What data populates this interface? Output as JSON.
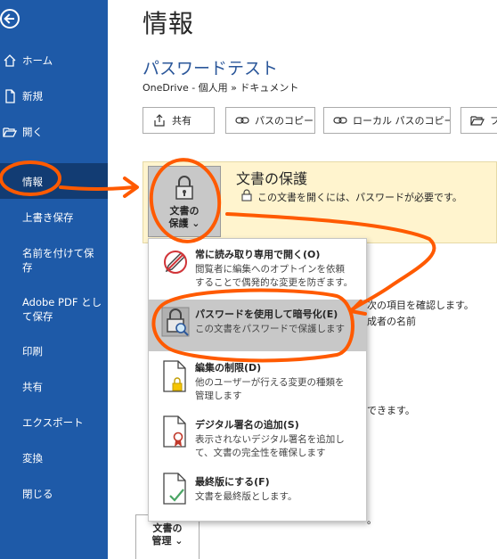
{
  "sidebar": {
    "items": [
      {
        "label": "ホーム"
      },
      {
        "label": "新規"
      },
      {
        "label": "開く"
      },
      {
        "label": "情報"
      },
      {
        "label": "上書き保存"
      },
      {
        "label": "名前を付けて保\n存"
      },
      {
        "label": "Adobe PDF とし\nて保存"
      },
      {
        "label": "印刷"
      },
      {
        "label": "共有"
      },
      {
        "label": "エクスポート"
      },
      {
        "label": "変換"
      },
      {
        "label": "閉じる"
      }
    ],
    "selected": "情報"
  },
  "header": {
    "page_title": "情報",
    "doc_title": "パスワードテスト",
    "doc_path": "OneDrive - 個人用 » ドキュメント"
  },
  "toolbar": {
    "share": "共有",
    "copy_path": "パスのコピー",
    "copy_local_path": "ローカル パスのコピー",
    "open_folder_partial": "ファ"
  },
  "protect": {
    "button_line1": "文書の",
    "button_line2": "保護 ⌄",
    "heading": "文書の保護",
    "description": "この文書を開くには、パスワードが必要です。"
  },
  "menu": {
    "items": [
      {
        "title": "常に読み取り専用で開く(O)",
        "desc1": "閲覧者に編集へのオプトインを依頼",
        "desc2": "することで偶発的な変更を防ぎます。"
      },
      {
        "title": "パスワードを使用して暗号化(E)",
        "desc1": "この文書をパスワードで保護します",
        "desc2": ""
      },
      {
        "title": "編集の制限(D)",
        "desc1": "他のユーザーが行える変更の種類を",
        "desc2": "管理します"
      },
      {
        "title": "デジタル署名の追加(S)",
        "desc1": "表示されないデジタル署名を追加し",
        "desc2": "て、文書の完全性を確保します"
      },
      {
        "title": "最終版にする(F)",
        "desc1": "文書を最終版とします。",
        "desc2": ""
      }
    ],
    "highlighted_index": 1
  },
  "background_text": {
    "inspect_line1": "次の項目を確認します。",
    "inspect_line2": "成者の名前",
    "versions_line": "できます。"
  },
  "manage": {
    "line1": "文書の",
    "line2": "管理 ⌄"
  },
  "colors": {
    "sidebar": "#1e5aa8",
    "sidebar_selected": "#123c73",
    "accent_title": "#2b579a",
    "protect_band": "#fff4ce",
    "annotation": "#ff5a00"
  },
  "icons": [
    "back-arrow-icon",
    "home-icon",
    "new-doc-icon",
    "open-folder-icon",
    "share-icon",
    "link-icon",
    "lock-key-icon",
    "pencil-forbidden-icon",
    "lock-magnifier-icon",
    "doc-lock-icon",
    "doc-ribbon-icon",
    "doc-check-icon"
  ]
}
